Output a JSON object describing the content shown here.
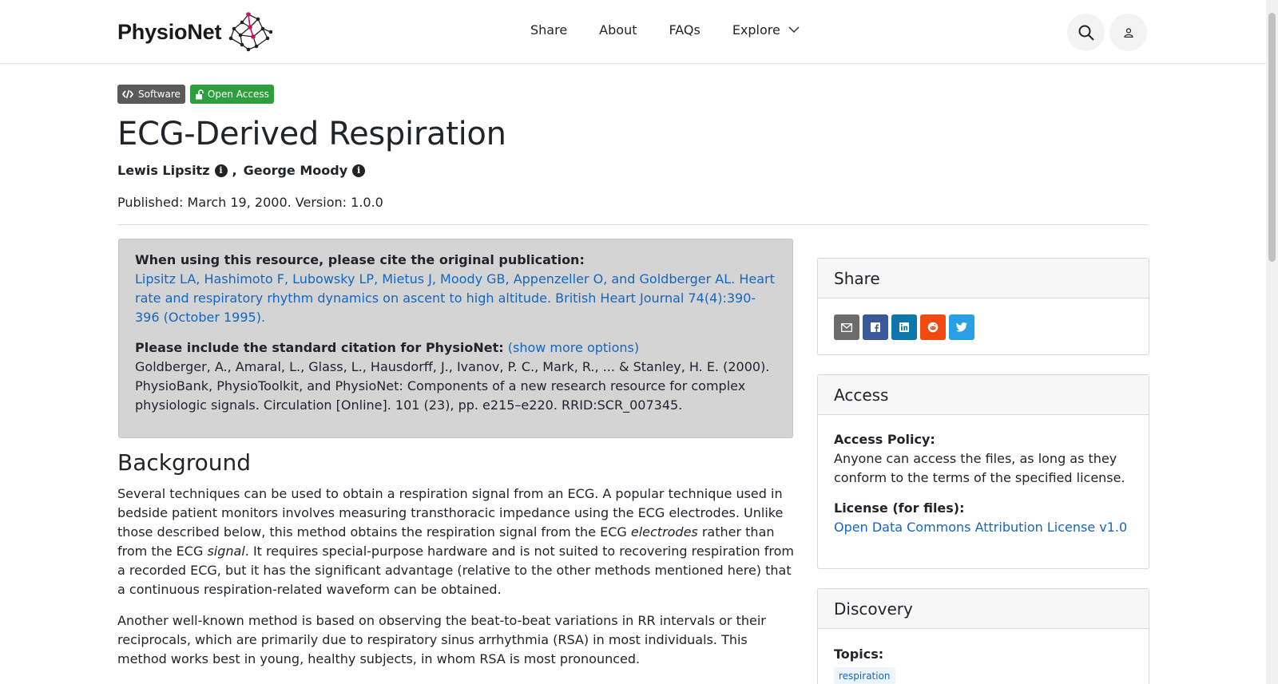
{
  "header": {
    "brand": "PhysioNet",
    "nav": [
      "Share",
      "About",
      "FAQs",
      "Explore"
    ],
    "search_icon": "search-icon",
    "user_icon": "user-icon"
  },
  "badges": {
    "software": "Software",
    "open_access": "Open Access"
  },
  "project": {
    "title": "ECG-Derived Respiration",
    "authors": [
      "Lewis Lipsitz",
      "George Moody"
    ],
    "author_separator": ",",
    "published": "Published: March 19, 2000. Version: 1.0.0"
  },
  "citation": {
    "original_heading": "When using this resource, please cite the original publication:",
    "original_text": "Lipsitz LA, Hashimoto F, Lubowsky LP, Mietus J, Moody GB, Appenzeller O, and Goldberger AL. Heart rate and respiratory rhythm dynamics on ascent to high altitude. British Heart Journal 74(4):390-396 (October 1995).",
    "standard_heading": "Please include the standard citation for PhysioNet:",
    "show_more": "(show more options)",
    "standard_text": "Goldberger, A., Amaral, L., Glass, L., Hausdorff, J., Ivanov, P. C., Mark, R., ... & Stanley, H. E. (2000). PhysioBank, PhysioToolkit, and PhysioNet: Components of a new research resource for complex physiologic signals. Circulation [Online]. 101 (23), pp. e215–e220. RRID:SCR_007345."
  },
  "background": {
    "heading": "Background",
    "p1_a": "Several techniques can be used to obtain a respiration signal from an ECG. A popular technique used in bedside patient monitors involves measuring transthoracic impedance using the ECG electrodes. Unlike those described below, this method obtains the respiration signal from the ECG ",
    "p1_em1": "electrodes",
    "p1_b": " rather than from the ECG ",
    "p1_em2": "signal",
    "p1_c": ". It requires special-purpose hardware and is not suited to recovering respiration from a recorded ECG, but it has the significant advantage (relative to the other methods mentioned here) that a continuous respiration-related waveform can be obtained.",
    "p2": "Another well-known method is based on observing the beat-to-beat variations in RR intervals or their reciprocals, which are primarily due to respiratory sinus arrhythmia (RSA) in most individuals. This method works best in young, healthy subjects, in whom RSA is most pronounced."
  },
  "sidebar": {
    "share": {
      "title": "Share",
      "buttons": [
        "email-icon",
        "facebook-icon",
        "linkedin-icon",
        "reddit-icon",
        "twitter-icon"
      ]
    },
    "access": {
      "title": "Access",
      "policy_label": "Access Policy:",
      "policy_text": "Anyone can access the files, as long as they conform to the terms of the specified license.",
      "license_label": "License (for files):",
      "license_link": "Open Data Commons Attribution License v1.0"
    },
    "discovery": {
      "title": "Discovery",
      "topics_label": "Topics:",
      "topics": [
        "respiration"
      ]
    }
  },
  "colors": {
    "link": "#1466c0",
    "open_access": "#2e9e3e",
    "software": "#5a5a5a",
    "citation_bg": "#d4d4d5"
  }
}
